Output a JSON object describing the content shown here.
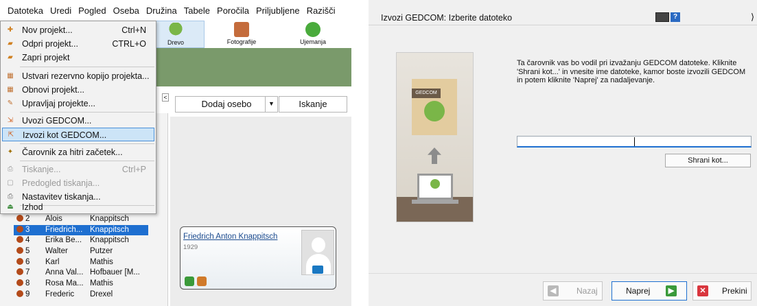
{
  "menubar": {
    "items": [
      "Datoteka",
      "Uredi",
      "Pogled",
      "Oseba",
      "Družina",
      "Tabele",
      "Poročila",
      "Priljubljene",
      "Razišči"
    ]
  },
  "toolbar": {
    "drevo": "Drevo",
    "fotografije": "Fotografije",
    "ujemanja": "Ujemanja"
  },
  "file_menu": {
    "items": [
      {
        "label": "Nov projekt...",
        "shortcut": "Ctrl+N",
        "icon": "new-project-icon"
      },
      {
        "label": "Odpri projekt...",
        "shortcut": "CTRL+O",
        "icon": "open-project-icon"
      },
      {
        "label": "Zapri projekt",
        "shortcut": "",
        "icon": "close-project-icon"
      },
      {
        "label": "Ustvari rezervno kopijo projekta...",
        "shortcut": "",
        "icon": "backup-icon"
      },
      {
        "label": "Obnovi projekt...",
        "shortcut": "",
        "icon": "restore-icon"
      },
      {
        "label": "Upravljaj projekte...",
        "shortcut": "",
        "icon": "manage-projects-icon"
      },
      {
        "label": "Uvozi GEDCOM...",
        "shortcut": "",
        "icon": "import-gedcom-icon"
      },
      {
        "label": "Izvozi kot GEDCOM...",
        "shortcut": "",
        "icon": "export-gedcom-icon"
      },
      {
        "label": "Čarovnik za hitri začetek...",
        "shortcut": "",
        "icon": "wizard-icon"
      },
      {
        "label": "Tiskanje...",
        "shortcut": "Ctrl+P",
        "icon": "print-icon"
      },
      {
        "label": "Predogled tiskanja...",
        "shortcut": "",
        "icon": "print-preview-icon"
      },
      {
        "label": "Nastavitev tiskanja...",
        "shortcut": "",
        "icon": "print-setup-icon"
      },
      {
        "label": "Izhod",
        "shortcut": "",
        "icon": "exit-icon"
      }
    ]
  },
  "person_toolbar": {
    "add_person": "Dodaj osebo",
    "search": "Iskanje"
  },
  "people": [
    {
      "id": "2",
      "first": "Alois",
      "last": "Knappitsch"
    },
    {
      "id": "3",
      "first": "Friedrich...",
      "last": "Knappitsch"
    },
    {
      "id": "4",
      "first": "Erika Be...",
      "last": "Knappitsch"
    },
    {
      "id": "5",
      "first": "Walter",
      "last": "Putzer"
    },
    {
      "id": "6",
      "first": "Karl",
      "last": "Mathis"
    },
    {
      "id": "7",
      "first": "Anna Val...",
      "last": "Hofbauer [M..."
    },
    {
      "id": "8",
      "first": "Rosa Ma...",
      "last": "Mathis"
    },
    {
      "id": "9",
      "first": "Frederic",
      "last": "Drexel"
    }
  ],
  "person_card": {
    "name": "Friedrich Anton Knappitsch",
    "year": "1929"
  },
  "dialog": {
    "title": "Izvozi GEDCOM: Izberite datoteko",
    "gedcom_tag": "GEDCOM",
    "description": "Ta čarovnik vas bo vodil pri izvažanju GEDCOM datoteke. Kliknite 'Shrani kot...' in vnesite ime datoteke, kamor boste izvozili GEDCOM in potem kliknite 'Naprej' za nadaljevanje.",
    "file_path": "",
    "save_as": "Shrani kot...",
    "back": "Nazaj",
    "next": "Naprej",
    "cancel": "Prekini"
  },
  "colors": {
    "selection": "#1e6fd0",
    "menu_highlight": "#cce4f7",
    "green_header": "#7a9a6b"
  }
}
